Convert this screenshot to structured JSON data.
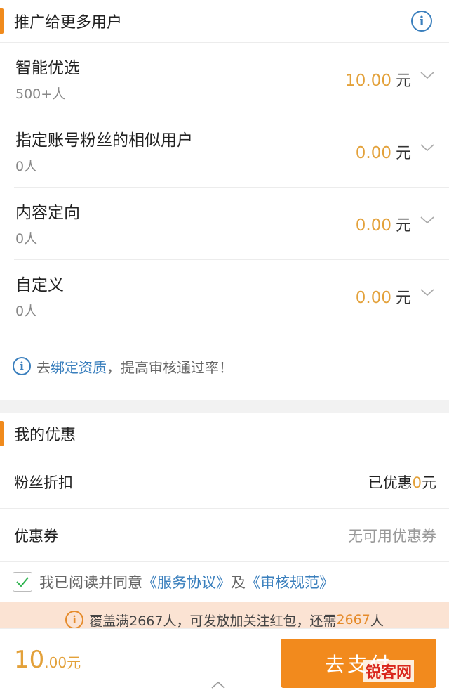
{
  "promote": {
    "title": "推广给更多用户",
    "info_icon": "info-icon",
    "options": [
      {
        "name": "智能优选",
        "count": "500+人",
        "price": "10.00",
        "unit": "元"
      },
      {
        "name": "指定账号粉丝的相似用户",
        "count": "0人",
        "price": "0.00",
        "unit": "元"
      },
      {
        "name": "内容定向",
        "count": "0人",
        "price": "0.00",
        "unit": "元"
      },
      {
        "name": "自定义",
        "count": "0人",
        "price": "0.00",
        "unit": "元"
      }
    ],
    "tip": {
      "prefix": "去",
      "link": "绑定资质",
      "suffix": "，提高审核通过率！"
    }
  },
  "discount": {
    "title": "我的优惠",
    "fans_label": "粉丝折扣",
    "fans_value_prefix": "已优惠",
    "fans_value_amount": "0",
    "fans_value_unit": "元",
    "coupon_label": "优惠券",
    "coupon_value": "无可用优惠券"
  },
  "agreement": {
    "checked": true,
    "prefix": "我已阅读并同意",
    "link1": "《服务协议》",
    "joiner": "及",
    "link2": "《审核规范》"
  },
  "notice": {
    "text1": "覆盖满2667人，可发放加关注红包，还需",
    "highlight": "2667",
    "text2": "人"
  },
  "footer": {
    "total_int": "10",
    "total_dec": ".00元",
    "pay_label": "去支付",
    "watermark": "锐客网"
  },
  "colors": {
    "accent": "#f28a1d",
    "price": "#e3a13a",
    "link": "#3a7fbd"
  }
}
